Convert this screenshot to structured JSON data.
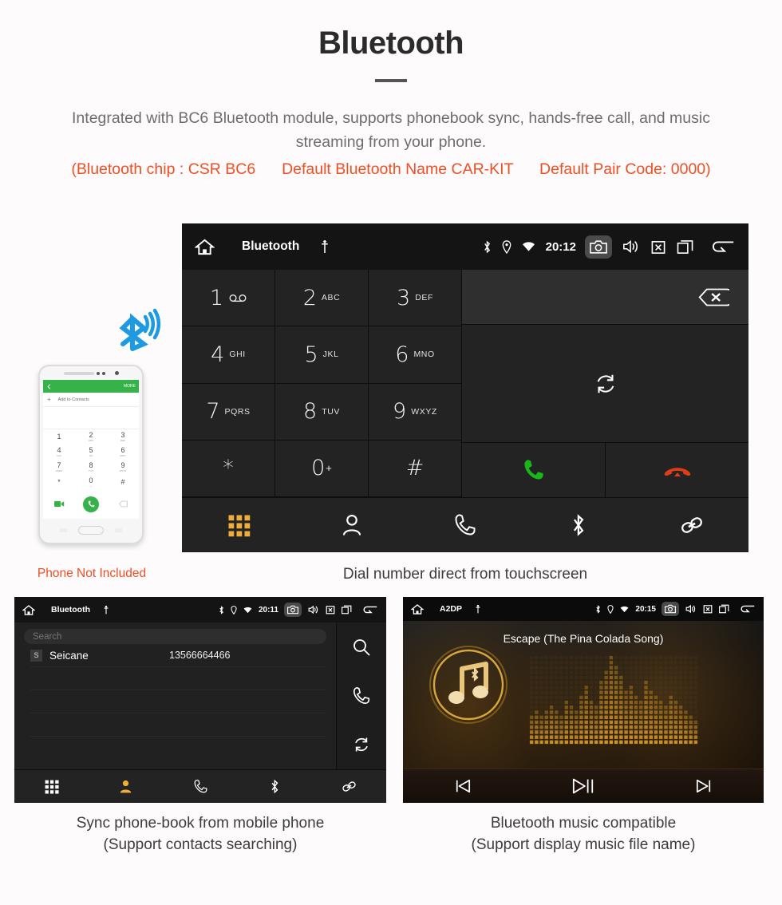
{
  "header": {
    "title": "Bluetooth",
    "description": "Integrated with BC6 Bluetooth module, supports phonebook sync, hands-free call, and music streaming from your phone.",
    "spec_chip": "(Bluetooth chip : CSR BC6",
    "spec_name": "Default Bluetooth Name CAR-KIT",
    "spec_pair": "Default Pair Code: 0000)"
  },
  "colors": {
    "accent_orange": "#f04e23",
    "key_active": "#f0ad3c",
    "call_green": "#18b818",
    "hangup_red": "#e03c18",
    "screen_bg": "#1b1b1b",
    "key_bg": "#232323"
  },
  "dialer": {
    "topbar": {
      "home_icon": "home-icon",
      "title": "Bluetooth",
      "usb_icon": "usb-icon",
      "bluetooth_icon": "bluetooth-icon",
      "location_icon": "location-icon",
      "wifi_icon": "wifi-icon",
      "time": "20:12",
      "camera_icon": "camera-icon",
      "volume_icon": "speaker-icon",
      "close_icon": "close-box-icon",
      "recents_icon": "recent-apps-icon",
      "back_icon": "back-arrow-icon"
    },
    "keys": [
      {
        "digit": "1",
        "sub": "",
        "icon": "voicemail-icon"
      },
      {
        "digit": "2",
        "sub": "ABC",
        "icon": ""
      },
      {
        "digit": "3",
        "sub": "DEF",
        "icon": ""
      },
      {
        "digit": "4",
        "sub": "GHI",
        "icon": ""
      },
      {
        "digit": "5",
        "sub": "JKL",
        "icon": ""
      },
      {
        "digit": "6",
        "sub": "MNO",
        "icon": ""
      },
      {
        "digit": "7",
        "sub": "PQRS",
        "icon": ""
      },
      {
        "digit": "8",
        "sub": "TUV",
        "icon": ""
      },
      {
        "digit": "9",
        "sub": "WXYZ",
        "icon": ""
      },
      {
        "digit": "*",
        "sub": "",
        "icon": ""
      },
      {
        "digit": "0",
        "sub": "+",
        "icon": ""
      },
      {
        "digit": "#",
        "sub": "",
        "icon": ""
      }
    ],
    "number_field_value": "",
    "backspace_icon": "backspace-icon",
    "sync_icon": "sync-icon",
    "call_icon": "call-icon",
    "hangup_icon": "hangup-icon",
    "nav": [
      {
        "name": "keypad",
        "icon": "keypad-grid-icon",
        "active": true
      },
      {
        "name": "contacts",
        "icon": "person-icon",
        "active": false
      },
      {
        "name": "call-log",
        "icon": "phone-handset-icon",
        "active": false
      },
      {
        "name": "bluetooth",
        "icon": "bluetooth-icon",
        "active": false
      },
      {
        "name": "pair",
        "icon": "link-icon",
        "active": false
      }
    ],
    "caption": "Dial number direct from touchscreen"
  },
  "phone_mock": {
    "bluetooth_signal_icon": "bluetooth-signal-icon",
    "app_back_icon": "back-arrow-icon",
    "app_more_label": "MORE",
    "add_contacts_label": "Add to Contacts",
    "keys": [
      {
        "d": "1",
        "s": ""
      },
      {
        "d": "2",
        "s": "ABC"
      },
      {
        "d": "3",
        "s": "DEF"
      },
      {
        "d": "4",
        "s": "GHI"
      },
      {
        "d": "5",
        "s": "JKL"
      },
      {
        "d": "6",
        "s": "MNO"
      },
      {
        "d": "7",
        "s": "PQRS"
      },
      {
        "d": "8",
        "s": "TUV"
      },
      {
        "d": "9",
        "s": "WXYZ"
      },
      {
        "d": "*",
        "s": ""
      },
      {
        "d": "0",
        "s": "+"
      },
      {
        "d": "#",
        "s": ""
      }
    ],
    "video_call_icon": "video-call-icon",
    "call_icon": "call-icon",
    "backspace_icon": "backspace-icon",
    "not_included_label": "Phone Not Included"
  },
  "contacts_screen": {
    "topbar": {
      "title": "Bluetooth",
      "time": "20:11"
    },
    "search_placeholder": "Search",
    "rows": [
      {
        "initial": "S",
        "name": "Seicane",
        "number": "13566664466"
      }
    ],
    "side_icons": [
      {
        "name": "search",
        "icon": "search-icon"
      },
      {
        "name": "dial",
        "icon": "phone-handset-icon"
      },
      {
        "name": "sync",
        "icon": "sync-icon"
      }
    ],
    "nav": [
      {
        "name": "keypad",
        "icon": "keypad-grid-icon",
        "active": false
      },
      {
        "name": "contacts",
        "icon": "person-icon",
        "active": true
      },
      {
        "name": "call-log",
        "icon": "phone-handset-icon",
        "active": false
      },
      {
        "name": "bluetooth",
        "icon": "bluetooth-icon",
        "active": false
      },
      {
        "name": "pair",
        "icon": "link-icon",
        "active": false
      }
    ],
    "caption_line1": "Sync phone-book from mobile phone",
    "caption_line2": "(Support contacts searching)"
  },
  "music_screen": {
    "topbar": {
      "title": "A2DP",
      "time": "20:15"
    },
    "track_title": "Escape (The Pina Colada Song)",
    "album_icon": "music-note-bluetooth-icon",
    "visualizer": "dot-matrix-spectrum",
    "controls": [
      {
        "name": "previous",
        "icon": "previous-track-icon"
      },
      {
        "name": "play-pause",
        "icon": "play-pause-icon"
      },
      {
        "name": "next",
        "icon": "next-track-icon"
      }
    ],
    "caption_line1": "Bluetooth music compatible",
    "caption_line2": "(Support display music file name)"
  }
}
